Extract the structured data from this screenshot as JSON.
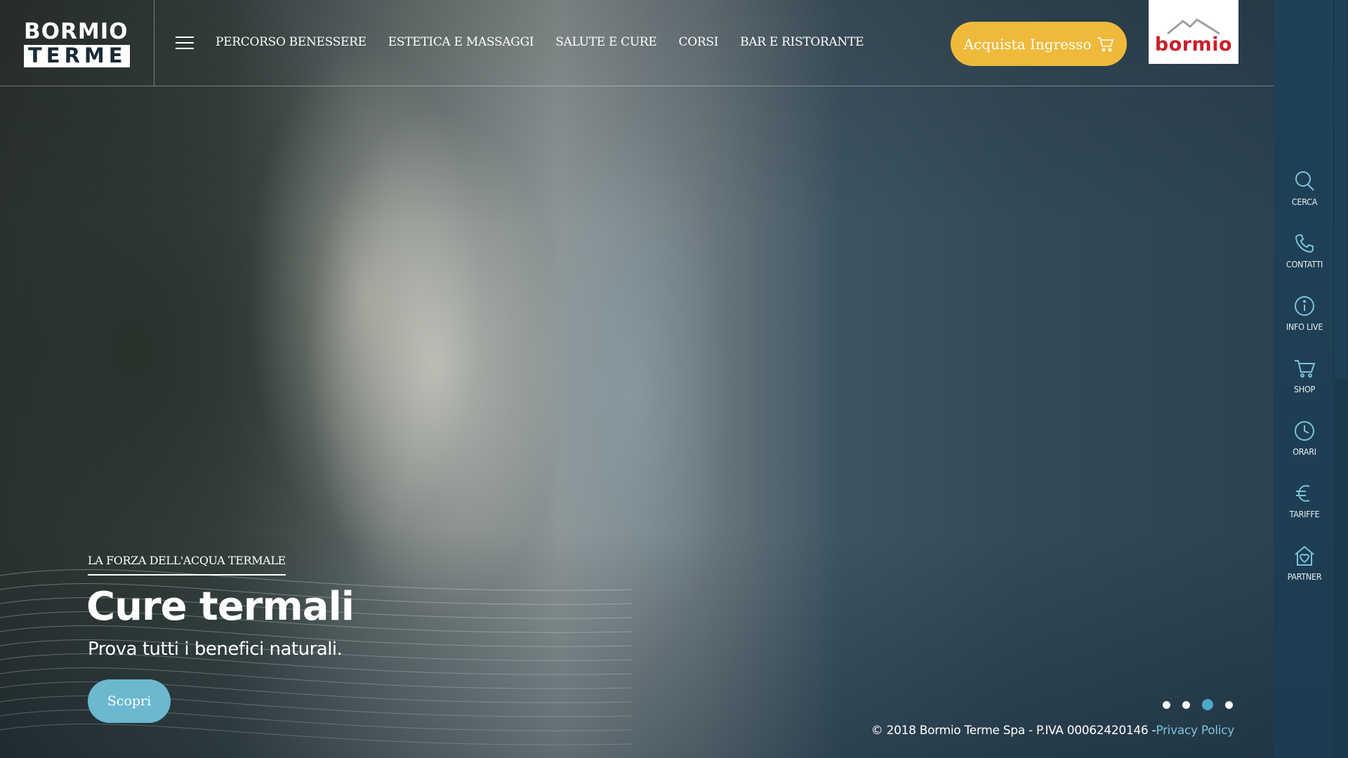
{
  "brand": {
    "logo_top": "BORMIO",
    "logo_bottom": "TERME",
    "partner_logo": "bormio"
  },
  "nav": {
    "menu_icon": "hamburger-menu-icon",
    "items": [
      {
        "label": "PERCORSO BENESSERE"
      },
      {
        "label": "ESTETICA E MASSAGGI"
      },
      {
        "label": "SALUTE E CURE"
      },
      {
        "label": "CORSI"
      },
      {
        "label": "BAR E RISTORANTE"
      }
    ]
  },
  "header": {
    "buy_button": {
      "label": "Acquista Ingresso",
      "icon": "cart-icon",
      "color": "#efba3b"
    }
  },
  "sidebar": {
    "items": [
      {
        "label": "CERCA",
        "icon": "search-icon"
      },
      {
        "label": "CONTATTI",
        "icon": "phone-icon"
      },
      {
        "label": "INFO LIVE",
        "icon": "info-icon"
      },
      {
        "label": "SHOP",
        "icon": "cart-icon"
      },
      {
        "label": "ORARI",
        "icon": "clock-icon"
      },
      {
        "label": "TARIFFE",
        "icon": "euro-icon"
      },
      {
        "label": "PARTNER",
        "icon": "home-heart-icon"
      }
    ],
    "color": "#1f4157"
  },
  "hero": {
    "eyebrow": "LA FORZA DELL'ACQUA TERMALE",
    "title": "Cure termali",
    "subtitle": "Prova tutti i benefici naturali.",
    "cta_label": "Scopri",
    "cta_color": "#6bb8cf"
  },
  "slider": {
    "total": 4,
    "active": 3
  },
  "footer": {
    "copyright": "© 2018 Bormio Terme Spa - P.IVA 00062420146 -",
    "privacy_link": "Privacy Policy"
  }
}
